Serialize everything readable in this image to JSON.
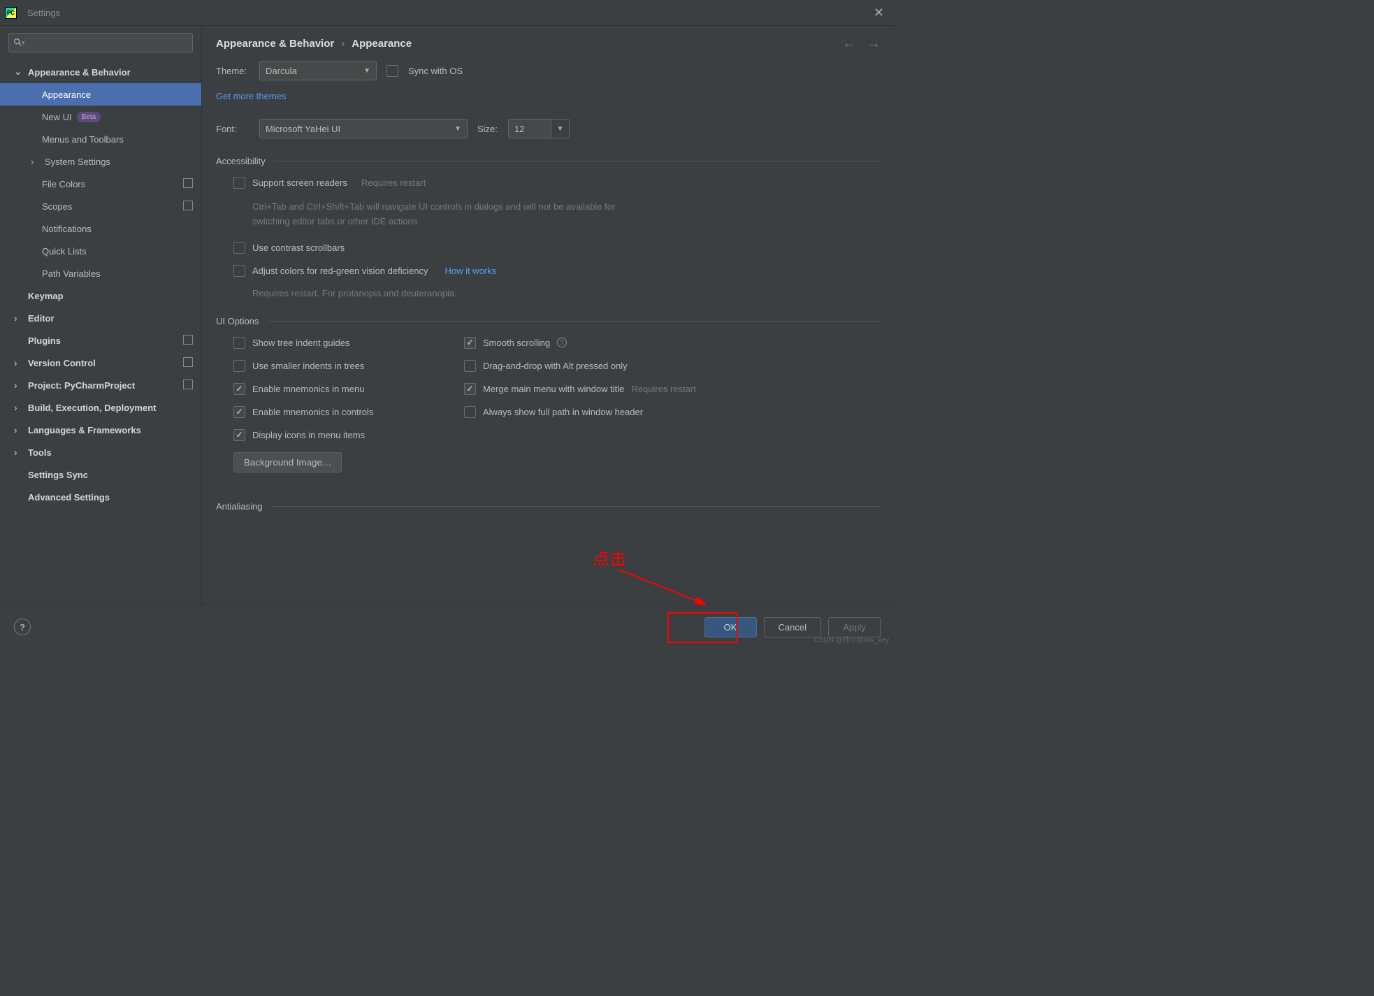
{
  "title": "Settings",
  "sidebar": {
    "items": [
      {
        "label": "Appearance & Behavior",
        "chev": "open",
        "top": true
      },
      {
        "label": "Appearance",
        "selected": true,
        "sub": true
      },
      {
        "label": "New UI",
        "sub": true,
        "badge": "Beta"
      },
      {
        "label": "Menus and Toolbars",
        "sub": true
      },
      {
        "label": "System Settings",
        "sub2": true,
        "chev": "closed"
      },
      {
        "label": "File Colors",
        "sub": true,
        "stack": true
      },
      {
        "label": "Scopes",
        "sub": true,
        "stack": true
      },
      {
        "label": "Notifications",
        "sub": true
      },
      {
        "label": "Quick Lists",
        "sub": true
      },
      {
        "label": "Path Variables",
        "sub": true
      },
      {
        "label": "Keymap",
        "top": true,
        "chev": "none"
      },
      {
        "label": "Editor",
        "top": true,
        "chev": "closed"
      },
      {
        "label": "Plugins",
        "top": true,
        "chev": "none",
        "stack": true
      },
      {
        "label": "Version Control",
        "top": true,
        "chev": "closed",
        "stack": true
      },
      {
        "label": "Project: PyCharmProject",
        "top": true,
        "chev": "closed",
        "stack": true
      },
      {
        "label": "Build, Execution, Deployment",
        "top": true,
        "chev": "closed"
      },
      {
        "label": "Languages & Frameworks",
        "top": true,
        "chev": "closed"
      },
      {
        "label": "Tools",
        "top": true,
        "chev": "closed"
      },
      {
        "label": "Settings Sync",
        "top": true,
        "chev": "none"
      },
      {
        "label": "Advanced Settings",
        "top": true,
        "chev": "none"
      }
    ]
  },
  "breadcrumb": {
    "a": "Appearance & Behavior",
    "b": "Appearance"
  },
  "theme": {
    "label": "Theme:",
    "value": "Darcula",
    "sync": "Sync with OS",
    "more": "Get more themes"
  },
  "font": {
    "label": "Font:",
    "value": "Microsoft YaHei UI",
    "sizeLabel": "Size:",
    "size": "12"
  },
  "accessibility": {
    "title": "Accessibility",
    "screen": "Support screen readers",
    "screenHint": "Requires restart",
    "screenDesc": "Ctrl+Tab and Ctrl+Shift+Tab will navigate UI controls in dialogs and will not be available for switching editor tabs or other IDE actions",
    "contrast": "Use contrast scrollbars",
    "colorblind": "Adjust colors for red-green vision deficiency",
    "how": "How it works",
    "colorblindHint": "Requires restart. For protanopia and deuteranopia."
  },
  "ui": {
    "title": "UI Options",
    "tree": "Show tree indent guides",
    "smaller": "Use smaller indents in trees",
    "mnemMenu": "Enable mnemonics in menu",
    "mnemCtrl": "Enable mnemonics in controls",
    "icons": "Display icons in menu items",
    "bgimg": "Background Image…",
    "smooth": "Smooth scrolling",
    "dnd": "Drag-and-drop with Alt pressed only",
    "merge": "Merge main menu with window title",
    "mergeHint": "Requires restart",
    "fullpath": "Always show full path in window header"
  },
  "antialiasing": {
    "title": "Antialiasing"
  },
  "footer": {
    "ok": "OK",
    "cancel": "Cancel",
    "apply": "Apply"
  },
  "annotation": {
    "text": "点击",
    "watermark": "CSDN @帅小伙low_key"
  }
}
